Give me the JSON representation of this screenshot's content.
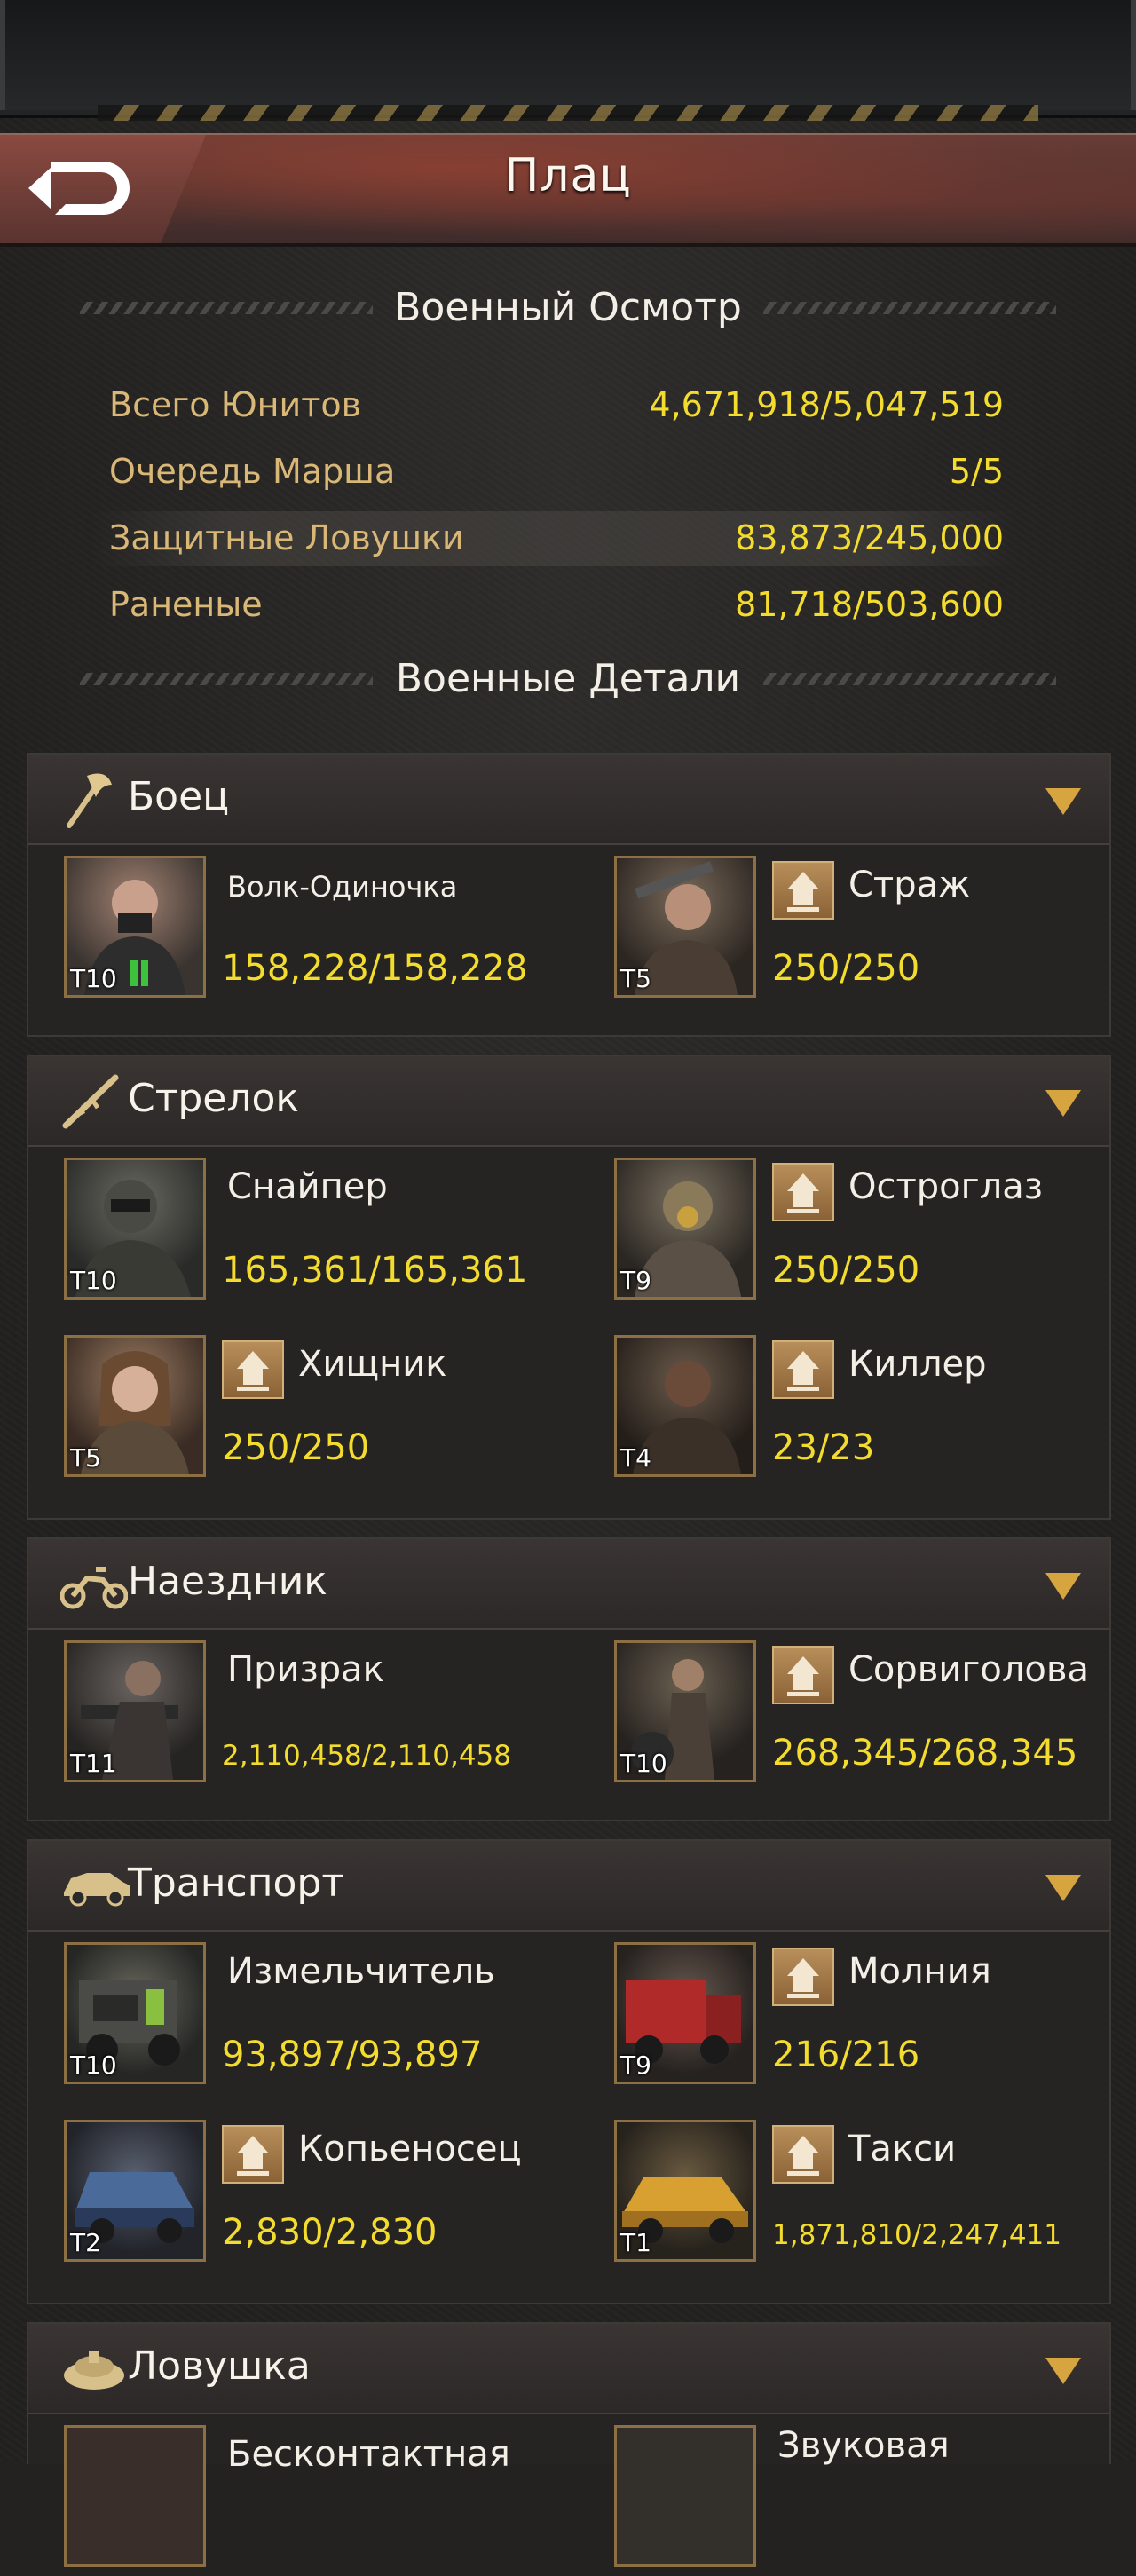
{
  "header": {
    "title": "Плац"
  },
  "overview": {
    "title": "Военный Осмотр",
    "stats": [
      {
        "label": "Всего Юнитов",
        "value": "4,671,918/5,047,519"
      },
      {
        "label": "Очередь Марша",
        "value": "5/5"
      },
      {
        "label": "Защитные Ловушки",
        "value": "83,873/245,000"
      },
      {
        "label": "Раненые",
        "value": "81,718/503,600"
      }
    ]
  },
  "details": {
    "title": "Военные Детали"
  },
  "categories": [
    {
      "name": "Боец",
      "icon": "axe-icon",
      "units": [
        {
          "name": "Волк-Одиночка",
          "tier": "T10",
          "count": "158,228/158,228",
          "upgrade": false
        },
        {
          "name": "Страж",
          "tier": "T5",
          "count": "250/250",
          "upgrade": true
        }
      ]
    },
    {
      "name": "Стрелок",
      "icon": "rifle-icon",
      "units": [
        {
          "name": "Снайпер",
          "tier": "T10",
          "count": "165,361/165,361",
          "upgrade": false
        },
        {
          "name": "Остроглаз",
          "tier": "T9",
          "count": "250/250",
          "upgrade": true
        },
        {
          "name": "Хищник",
          "tier": "T5",
          "count": "250/250",
          "upgrade": true
        },
        {
          "name": "Киллер",
          "tier": "T4",
          "count": "23/23",
          "upgrade": true
        }
      ]
    },
    {
      "name": "Наездник",
      "icon": "motorcycle-icon",
      "units": [
        {
          "name": "Призрак",
          "tier": "T11",
          "count": "2,110,458/2,110,458",
          "upgrade": false
        },
        {
          "name": "Сорвиголова",
          "tier": "T10",
          "count": "268,345/268,345",
          "upgrade": true
        }
      ]
    },
    {
      "name": "Транспорт",
      "icon": "car-icon",
      "units": [
        {
          "name": "Измельчитель",
          "tier": "T10",
          "count": "93,897/93,897",
          "upgrade": false
        },
        {
          "name": "Молния",
          "tier": "T9",
          "count": "216/216",
          "upgrade": true
        },
        {
          "name": "Копьеносец",
          "tier": "T2",
          "count": "2,830/2,830",
          "upgrade": true
        },
        {
          "name": "Такси",
          "tier": "T1",
          "count": "1,871,810/2,247,411",
          "upgrade": true
        }
      ]
    },
    {
      "name": "Ловушка",
      "icon": "landmine-icon",
      "units": [
        {
          "name": "Бесконтактная",
          "tier": "",
          "count": "",
          "upgrade": false
        },
        {
          "name": "Звуковая",
          "tier": "",
          "count": "",
          "upgrade": false
        }
      ]
    }
  ]
}
